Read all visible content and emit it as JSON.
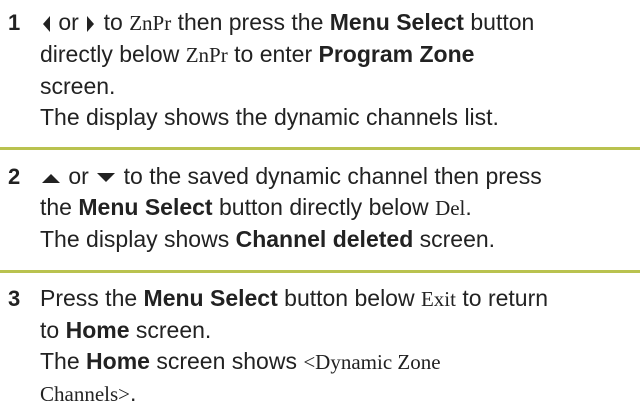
{
  "steps": [
    {
      "number": "1",
      "text": {
        "t1": "or",
        "t2": "to",
        "code1": "ZnPr",
        "t3": "then press the",
        "menu_select": "Menu Select",
        "t4": "button",
        "t5": "directly below",
        "code2": "ZnPr",
        "t6": "to enter",
        "program_zone": "Program Zone",
        "t7": "screen.",
        "t8": "The display shows the dynamic channels list."
      },
      "icons": [
        "left-arrow-icon",
        "right-arrow-icon"
      ]
    },
    {
      "number": "2",
      "text": {
        "t1": "or",
        "t2": "to the saved dynamic channel then press",
        "t3": "the",
        "menu_select": "Menu Select",
        "t4": "button directly below",
        "code": "Del",
        "t5": ".",
        "t6": "The display shows",
        "channel_deleted": "Channel deleted",
        "t7": "screen."
      },
      "icons": [
        "up-arrow-icon",
        "down-arrow-icon"
      ]
    },
    {
      "number": "3",
      "text": {
        "t1": "Press the",
        "menu_select": "Menu Select",
        "t2": "button below",
        "code": "Exit",
        "t3": "to return",
        "t4": "to",
        "home": "Home",
        "t5": "screen.",
        "t6": "The",
        "home2": "Home",
        "t7": "screen shows",
        "code2": "<Dynamic Zone",
        "code3": "Channels>",
        "t8": "."
      }
    }
  ],
  "colors": {
    "rule": "#b9c24f",
    "text": "#222222"
  }
}
